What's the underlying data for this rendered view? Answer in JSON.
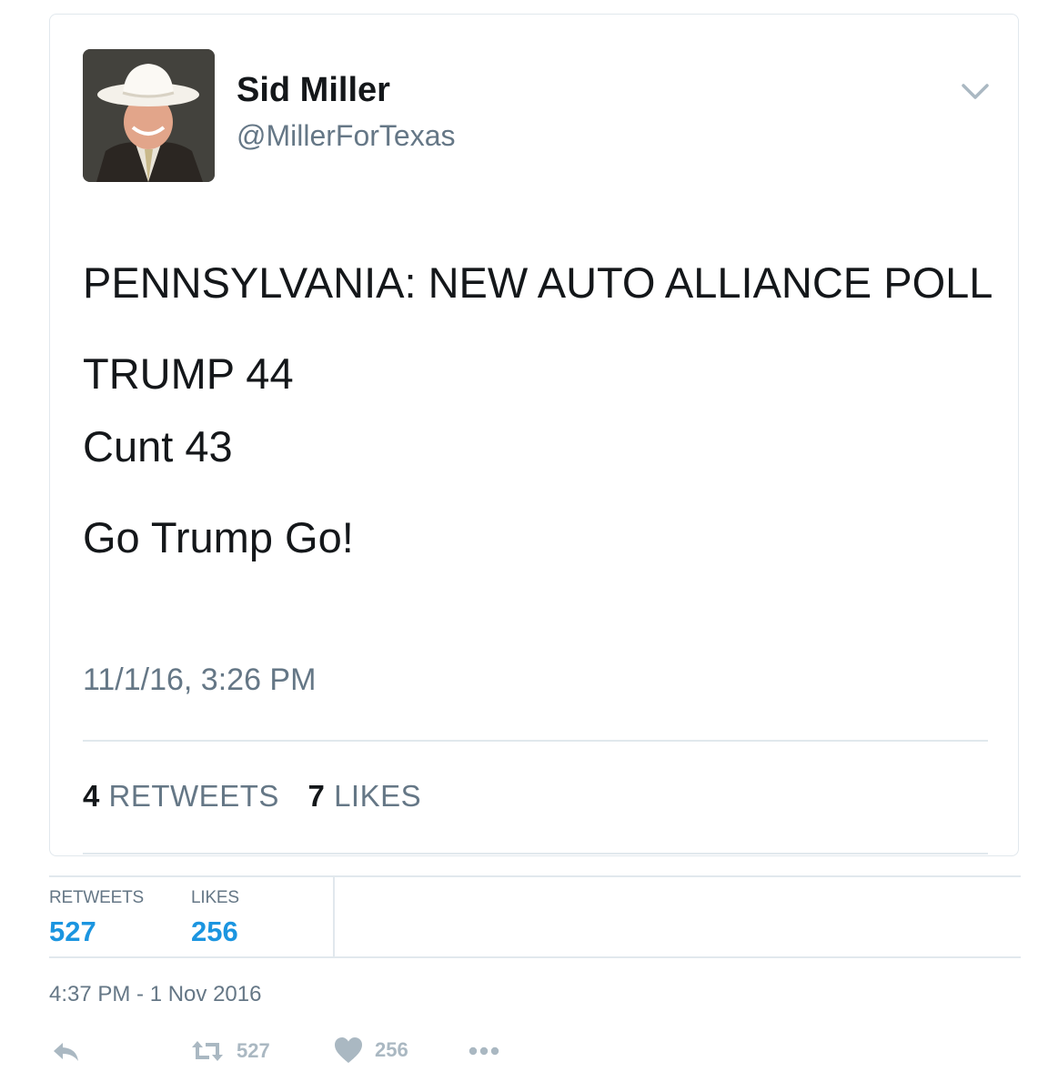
{
  "embedded_tweet": {
    "author_name": "Sid Miller",
    "author_handle": "@MillerForTexas",
    "text_lines": [
      "PENNSYLVANIA: NEW AUTO ALLIANCE POLL",
      "TRUMP 44",
      "Cunt 43",
      "Go Trump Go!"
    ],
    "timestamp": "11/1/16, 3:26 PM",
    "retweets_count": "4",
    "retweets_label": "RETWEETS",
    "likes_count": "7",
    "likes_label": "LIKES"
  },
  "tweet_stats": {
    "retweets_label": "RETWEETS",
    "retweets_value": "527",
    "likes_label": "LIKES",
    "likes_value": "256"
  },
  "timestamp": "4:37 PM - 1 Nov 2016",
  "actions": {
    "reply_icon": "reply-icon",
    "retweet_icon": "retweet-icon",
    "retweet_count": "527",
    "like_icon": "heart-icon",
    "like_count": "256",
    "more_icon": "more-dots-icon"
  },
  "colors": {
    "link_blue": "#1b95e0",
    "text_dark": "#14171a",
    "text_gray": "#657786",
    "icon_gray": "#aab8c2",
    "border": "#e1e8ed"
  }
}
